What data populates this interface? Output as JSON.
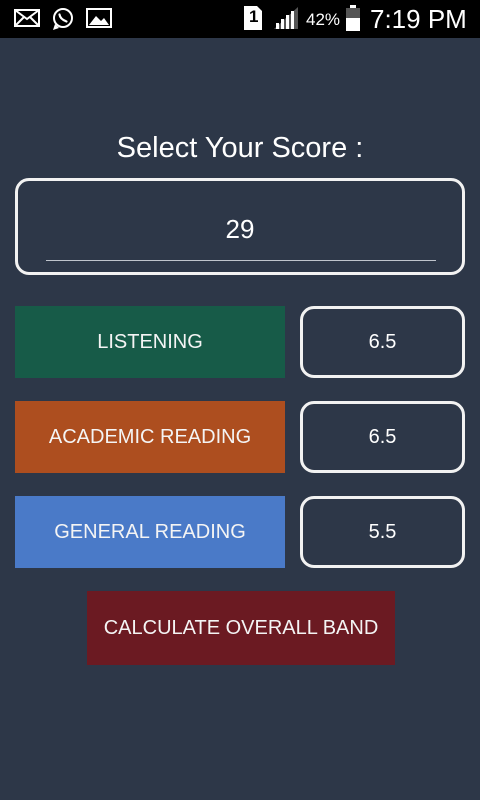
{
  "status_bar": {
    "icons": [
      "mail-icon",
      "whatsapp-icon",
      "gallery-icon",
      "sim-1-icon",
      "signal-icon",
      "battery-icon"
    ],
    "sim_label": "1",
    "battery_percent": "42%",
    "time": "7:19 PM"
  },
  "screen": {
    "title": "Select Your Score :",
    "score_value": "29"
  },
  "categories": [
    {
      "label": "LISTENING",
      "band": "6.5",
      "color": "#175b48"
    },
    {
      "label": "ACADEMIC READING",
      "band": "6.5",
      "color": "#ad4e1f"
    },
    {
      "label": "GENERAL READING",
      "band": "5.5",
      "color": "#4a7ac8"
    }
  ],
  "calculate_button": {
    "label": "CALCULATE OVERALL BAND",
    "color": "#6b1a22"
  },
  "colors": {
    "background": "#2d3748",
    "status_bar": "#000000",
    "border": "#f2f2f2"
  }
}
